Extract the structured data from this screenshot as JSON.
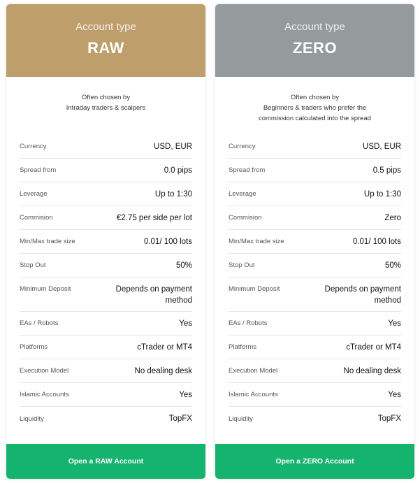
{
  "colors": {
    "raw": "#be9e6a",
    "zero": "#959b9c",
    "button": "#14b46e"
  },
  "cards": [
    {
      "title": "Account type",
      "name": "RAW",
      "chosen_by": "Often chosen by",
      "audience": "Intraday traders & scalpers",
      "audience2": "",
      "rows": [
        [
          "Currency",
          "USD, EUR"
        ],
        [
          "Spread from",
          "0.0 pips"
        ],
        [
          "Leverage",
          "Up to 1:30"
        ],
        [
          "Commision",
          "€2.75 per side per lot"
        ],
        [
          "Min/Max trade size",
          "0.01/ 100 lots"
        ],
        [
          "Stop Out",
          "50%"
        ],
        [
          "Minimum Deposit",
          "Depends on payment method"
        ],
        [
          "EAs / Robots",
          "Yes"
        ],
        [
          "Platforms",
          "cTrader or MT4"
        ],
        [
          "Execution Model",
          "No dealing desk"
        ],
        [
          "Islamic Accounts",
          "Yes"
        ],
        [
          "Liquidity",
          "TopFX"
        ]
      ],
      "button": "Open a RAW Account"
    },
    {
      "title": "Account type",
      "name": "ZERO",
      "chosen_by": "Often chosen by",
      "audience": "Beginners & traders who prefer the",
      "audience2": "commission calculated into the spread",
      "rows": [
        [
          "Currency",
          "USD, EUR"
        ],
        [
          "Spread from",
          "0.5 pips"
        ],
        [
          "Leverage",
          "Up to 1:30"
        ],
        [
          "Commision",
          "Zero"
        ],
        [
          "Min/Max trade size",
          "0.01/ 100 lots"
        ],
        [
          "Stop Out",
          "50%"
        ],
        [
          "Minimum Deposit",
          "Depends on payment method"
        ],
        [
          "EAs / Robots",
          "Yes"
        ],
        [
          "Platforms",
          "cTrader or MT4"
        ],
        [
          "Execution Model",
          "No dealing desk"
        ],
        [
          "Islamic Accounts",
          "Yes"
        ],
        [
          "Liquidity",
          "TopFX"
        ]
      ],
      "button": "Open a ZERO Account"
    }
  ]
}
